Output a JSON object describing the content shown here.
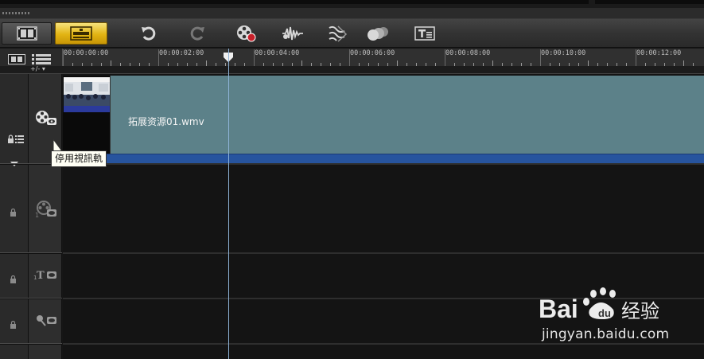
{
  "toolbar": {
    "buttons": [
      {
        "name": "storyboard-view",
        "icon": "film-strip-icon"
      },
      {
        "name": "timeline-view",
        "icon": "timeline-icon",
        "active": true
      },
      {
        "name": "undo",
        "icon": "undo-icon"
      },
      {
        "name": "redo",
        "icon": "redo-icon"
      },
      {
        "name": "record-capture",
        "icon": "film-reel-record-icon"
      },
      {
        "name": "sound-mixer",
        "icon": "audio-wave-icon"
      },
      {
        "name": "auto-music",
        "icon": "music-wave-icon"
      },
      {
        "name": "motion-tracking",
        "icon": "spheres-icon"
      },
      {
        "name": "subtitle-editor",
        "icon": "title-text-icon"
      }
    ]
  },
  "ruler": {
    "add_remove_label": "+/-",
    "timecodes": [
      "00:00:00:00",
      "00:00:02:00",
      "00:00:04:00",
      "00:00:06:00",
      "00:00:08:00",
      "00:00:10:00",
      "00:00:12:00"
    ],
    "playhead_timecode": "00:00:03:00"
  },
  "tracks": [
    {
      "type": "video",
      "icon": "video-track-eye-icon"
    },
    {
      "type": "overlay",
      "icon": "overlay-track-icon"
    },
    {
      "type": "title",
      "icon": "title-track-icon",
      "label": "T"
    },
    {
      "type": "voice",
      "icon": "voice-track-icon"
    }
  ],
  "clip": {
    "name": "拓展资源01.wmv"
  },
  "tooltip": {
    "text": "停用視訊軌"
  },
  "watermark": {
    "brand_left": "Bai",
    "brand_right": "经验",
    "url": "jingyan.baidu.com"
  },
  "colors": {
    "clip_body": "#5c8189",
    "clip_strip": "#27549e",
    "active_button": "#e2b413",
    "playhead": "#8fb4d8"
  }
}
